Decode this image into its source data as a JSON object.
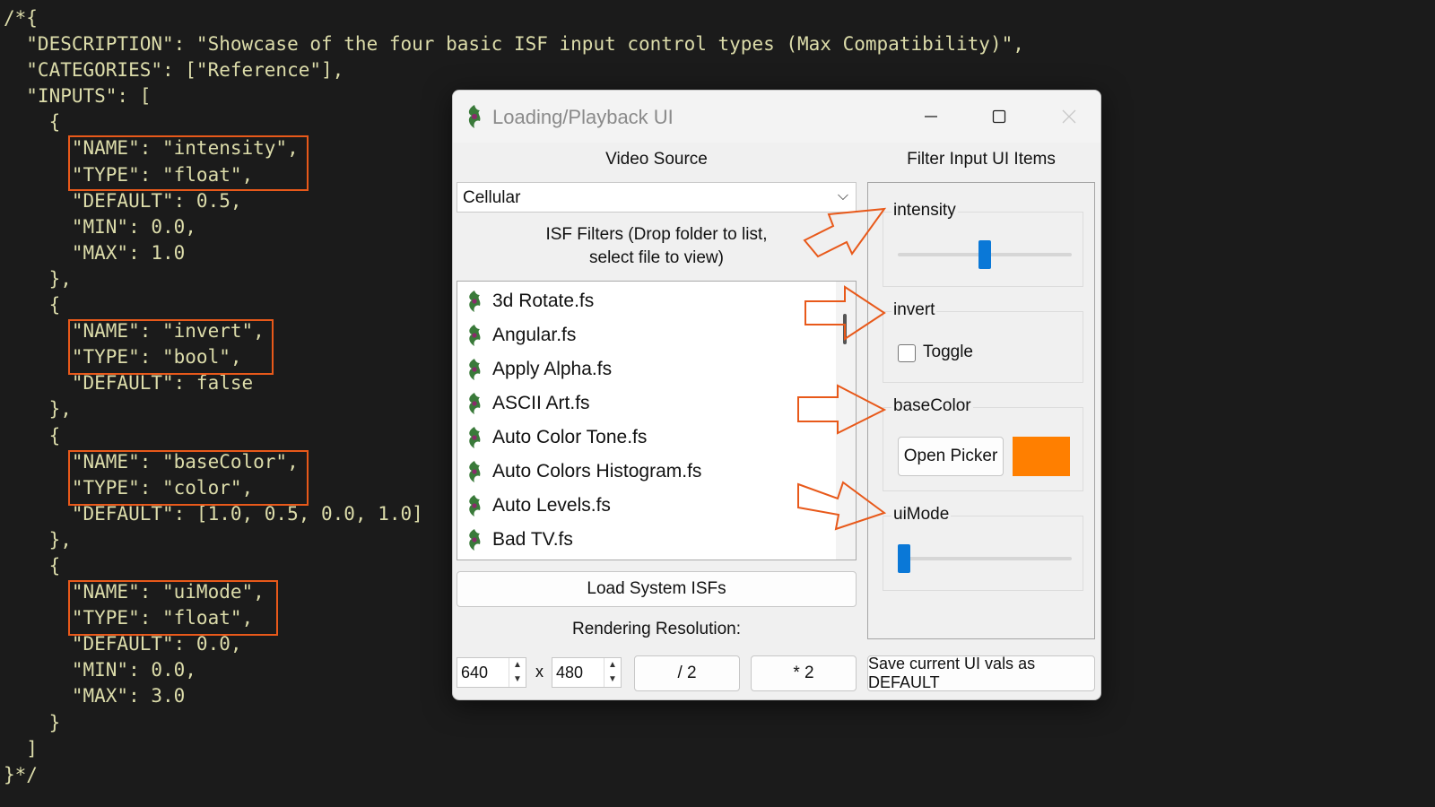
{
  "code": {
    "lines": [
      "/*{",
      "  \"DESCRIPTION\": \"Showcase of the four basic ISF input control types (Max Compatibility)\",",
      "  \"CATEGORIES\": [\"Reference\"],",
      "  \"INPUTS\": [",
      "    {",
      "      \"NAME\": \"intensity\",",
      "      \"TYPE\": \"float\",",
      "      \"DEFAULT\": 0.5,",
      "      \"MIN\": 0.0,",
      "      \"MAX\": 1.0",
      "    },",
      "    {",
      "      \"NAME\": \"invert\",",
      "      \"TYPE\": \"bool\",",
      "      \"DEFAULT\": false",
      "    },",
      "    {",
      "      \"NAME\": \"baseColor\",",
      "      \"TYPE\": \"color\",",
      "      \"DEFAULT\": [1.0, 0.5, 0.0, 1.0]",
      "    },",
      "    {",
      "      \"NAME\": \"uiMode\",",
      "      \"TYPE\": \"float\",",
      "      \"DEFAULT\": 0.0,",
      "      \"MIN\": 0.0,",
      "      \"MAX\": 3.0",
      "    }",
      "  ]",
      "}*/"
    ]
  },
  "window": {
    "title": "Loading/Playback UI",
    "minimize_icon": "minimize-icon",
    "maximize_icon": "maximize-icon",
    "close_icon": "close-icon"
  },
  "video_source": {
    "label": "Video Source",
    "selected": "Cellular"
  },
  "isf_filters": {
    "label_line1": "ISF Filters (Drop folder to list,",
    "label_line2": "select file to view)",
    "items": [
      "3d Rotate.fs",
      "Angular.fs",
      "Apply Alpha.fs",
      "ASCII Art.fs",
      "Auto Color Tone.fs",
      "Auto Colors Histogram.fs",
      "Auto Levels.fs",
      "Bad TV.fs"
    ]
  },
  "load_button": "Load System ISFs",
  "resolution": {
    "label": "Rendering Resolution:",
    "width": "640",
    "height": "480",
    "separator": "x",
    "half_button": "/ 2",
    "double_button": "* 2"
  },
  "filter_panel": {
    "label": "Filter Input UI Items",
    "intensity": {
      "title": "intensity",
      "value": 0.5
    },
    "invert": {
      "title": "invert",
      "toggle_label": "Toggle",
      "checked": false
    },
    "baseColor": {
      "title": "baseColor",
      "button": "Open Picker",
      "swatch_color": "#ff7f00"
    },
    "uiMode": {
      "title": "uiMode",
      "value": 0.0
    },
    "save_button": "Save current UI vals as DEFAULT"
  },
  "colors": {
    "accent": "#0a78d7",
    "highlight": "#e8591a",
    "code_text": "#dcdcaa",
    "background": "#1b1b1b"
  }
}
